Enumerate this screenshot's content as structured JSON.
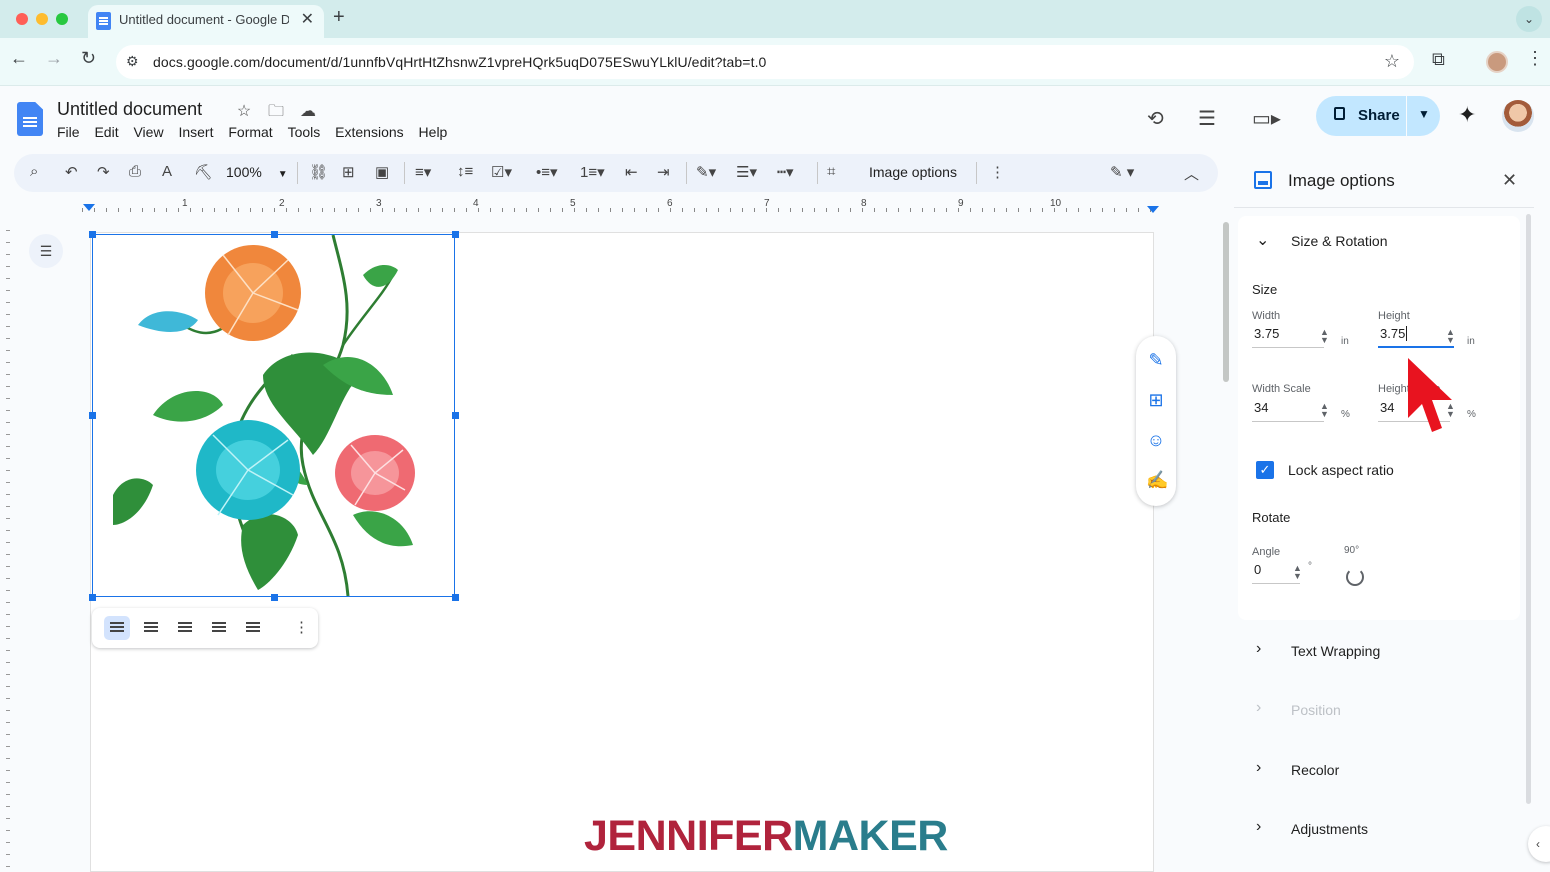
{
  "browser": {
    "tab_title": "Untitled document - Google Docs",
    "url": "docs.google.com/document/d/1unnfbVqHrtHtZhsnwZ1vpreHQrk5uqD075ESwuYLklU/edit?tab=t.0"
  },
  "doc": {
    "title": "Untitled document",
    "menu": [
      "File",
      "Edit",
      "View",
      "Insert",
      "Format",
      "Tools",
      "Extensions",
      "Help"
    ],
    "share_label": "Share"
  },
  "toolbar": {
    "zoom": "100%",
    "image_options_label": "Image options"
  },
  "ruler": {
    "numbers": [
      "1",
      "2",
      "3",
      "4",
      "5",
      "6",
      "7",
      "8",
      "9",
      "10"
    ]
  },
  "panel": {
    "title": "Image options",
    "size_rotation": {
      "title": "Size & Rotation",
      "size_heading": "Size",
      "width_label": "Width",
      "width_value": "3.75",
      "height_label": "Height",
      "height_value": "3.75",
      "unit_in": "in",
      "width_scale_label": "Width Scale",
      "width_scale_value": "34",
      "height_scale_label": "Height Scale",
      "height_scale_value": "34",
      "unit_pct": "%",
      "lock_label": "Lock aspect ratio",
      "lock_checked": true,
      "rotate_heading": "Rotate",
      "angle_label": "Angle",
      "angle_value": "0",
      "angle_unit": "°",
      "rotate_90_label": "90°"
    },
    "sections": [
      "Text Wrapping",
      "Position",
      "Recolor",
      "Adjustments"
    ]
  },
  "watermark": {
    "part1": "JENNIFER",
    "part2": "MAKER"
  },
  "colors": {
    "accent": "#1a73e8",
    "share_bg": "#c2e7ff",
    "cursor": "#e8131f",
    "watermark_red": "#b0233c",
    "watermark_teal": "#2a7d8c"
  }
}
